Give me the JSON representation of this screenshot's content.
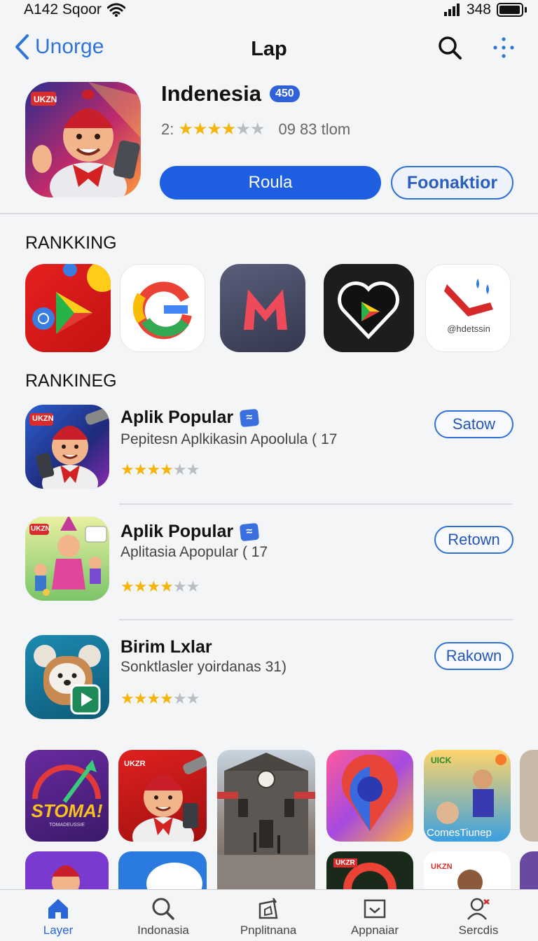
{
  "status": {
    "left_text": "A142 Sqoor",
    "right_text": "348"
  },
  "nav": {
    "back_label": "Unorge",
    "title": "Lap"
  },
  "hero": {
    "title": "Indenesia",
    "badge": "450",
    "rating_prefix": "2:",
    "rating_stars": 4,
    "meta": "09 83 tlom",
    "primary_button": "Roula",
    "secondary_button": "Foonaktior",
    "icon_tag": "UKZN"
  },
  "sections": {
    "ranking_1": "RANKKING",
    "ranking_2": "RANKINEG"
  },
  "ranking_icons": [
    {
      "name": "play-store-red"
    },
    {
      "name": "google-g"
    },
    {
      "name": "m-app"
    },
    {
      "name": "heart-play"
    },
    {
      "name": "drops-app",
      "caption": "@hdetssin"
    }
  ],
  "list": [
    {
      "title": "Aplik Popular",
      "subtitle": "Pepitesn Aplkikasin Apoolula ( 17",
      "stars": 4,
      "button": "Satow",
      "tag": "UKZN"
    },
    {
      "title": "Aplik Popular",
      "subtitle": "Aplitasia Apopular ( 17",
      "stars": 4,
      "button": "Retown",
      "tag": "UKZN"
    },
    {
      "title": "Birim Lxlar",
      "subtitle": "Sonktlasler yoirdanas 31)",
      "stars": 4,
      "button": "Rakown"
    }
  ],
  "grid": {
    "tile1_text": "STOMA!",
    "tile1_sub": "TOMADEUSSIE",
    "tile2_tag": "UKZR",
    "tile5_tag": "UICK",
    "tile5_caption": "ComesTiunep",
    "tile9_tag": "UKZR",
    "tile10_tag": "UKZN"
  },
  "tabs": [
    {
      "label": "Layer",
      "icon": "home-icon",
      "active": true
    },
    {
      "label": "Indonasia",
      "icon": "search-icon",
      "active": false
    },
    {
      "label": "Pnplitnana",
      "icon": "apps-icon",
      "active": false
    },
    {
      "label": "Appnaiar",
      "icon": "book-icon",
      "active": false
    },
    {
      "label": "Sercdis",
      "icon": "person-icon",
      "active": false
    }
  ],
  "colors": {
    "accent": "#1d5fe0",
    "star": "#f5b40a"
  }
}
